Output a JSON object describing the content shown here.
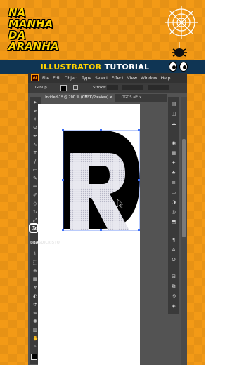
{
  "brand": {
    "line1": "NA",
    "line2": "MANHA",
    "line3": "DA",
    "line4": "ARANHA"
  },
  "banner": {
    "highlight": "ILLUSTRATOR",
    "rest": "TUTORIAL"
  },
  "app": {
    "badge": "Ai",
    "menu": [
      "File",
      "Edit",
      "Object",
      "Type",
      "Select",
      "Effect",
      "View",
      "Window",
      "Help"
    ],
    "control": {
      "selection_label": "Group",
      "stroke_label": "Stroke:"
    },
    "tabs": [
      {
        "label": "Untitled-1* @ 200 % (CMYK/Preview)",
        "close": "×"
      },
      {
        "label": "LOGOS.ai*",
        "close": "×"
      }
    ]
  },
  "watermark": {
    "social_handle": "@BASDICRISTO"
  },
  "colors": {
    "background": "#f39a16",
    "banner": "#0f3554",
    "brand_text": "#ffd400",
    "glyph_black": "#000000",
    "glyph_pattern": "#e8e8ef"
  },
  "icons": {
    "instagram": "instagram-icon",
    "web": "spider-web-icon",
    "spider": "spider-icon"
  }
}
